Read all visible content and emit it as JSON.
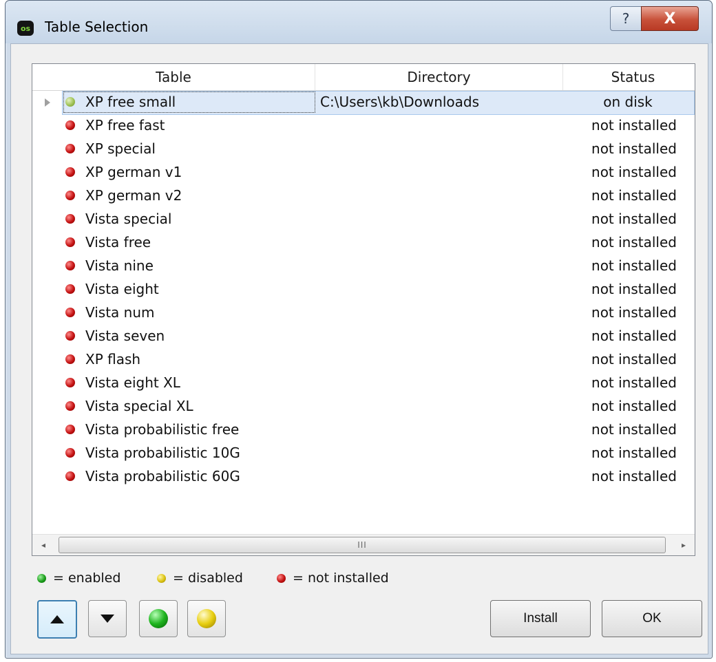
{
  "window": {
    "title": "Table Selection",
    "app_icon_text": "os",
    "help_glyph": "?",
    "close_glyph": "X"
  },
  "table": {
    "columns": [
      "Table",
      "Directory",
      "Status"
    ],
    "rows": [
      {
        "name": "XP free small",
        "directory": "C:\\Users\\kb\\Downloads",
        "status": "on disk",
        "indicator": "light-green",
        "selected": true
      },
      {
        "name": "XP free fast",
        "directory": "",
        "status": "not installed",
        "indicator": "red"
      },
      {
        "name": "XP special",
        "directory": "",
        "status": "not installed",
        "indicator": "red"
      },
      {
        "name": "XP german v1",
        "directory": "",
        "status": "not installed",
        "indicator": "red"
      },
      {
        "name": "XP german v2",
        "directory": "",
        "status": "not installed",
        "indicator": "red"
      },
      {
        "name": "Vista special",
        "directory": "",
        "status": "not installed",
        "indicator": "red"
      },
      {
        "name": "Vista free",
        "directory": "",
        "status": "not installed",
        "indicator": "red"
      },
      {
        "name": "Vista nine",
        "directory": "",
        "status": "not installed",
        "indicator": "red"
      },
      {
        "name": "Vista eight",
        "directory": "",
        "status": "not installed",
        "indicator": "red"
      },
      {
        "name": "Vista num",
        "directory": "",
        "status": "not installed",
        "indicator": "red"
      },
      {
        "name": "Vista seven",
        "directory": "",
        "status": "not installed",
        "indicator": "red"
      },
      {
        "name": "XP flash",
        "directory": "",
        "status": "not installed",
        "indicator": "red"
      },
      {
        "name": "Vista eight XL",
        "directory": "",
        "status": "not installed",
        "indicator": "red"
      },
      {
        "name": "Vista special XL",
        "directory": "",
        "status": "not installed",
        "indicator": "red"
      },
      {
        "name": "Vista probabilistic free",
        "directory": "",
        "status": "not installed",
        "indicator": "red"
      },
      {
        "name": "Vista probabilistic 10G",
        "directory": "",
        "status": "not installed",
        "indicator": "red"
      },
      {
        "name": "Vista probabilistic 60G",
        "directory": "",
        "status": "not installed",
        "indicator": "red"
      }
    ],
    "scroll_left_glyph": "◂",
    "scroll_right_glyph": "▸",
    "scroll_grip": "III"
  },
  "legend": {
    "enabled": "= enabled",
    "disabled": "= disabled",
    "not_installed": "= not installed"
  },
  "buttons": {
    "install": "Install",
    "ok": "OK"
  }
}
